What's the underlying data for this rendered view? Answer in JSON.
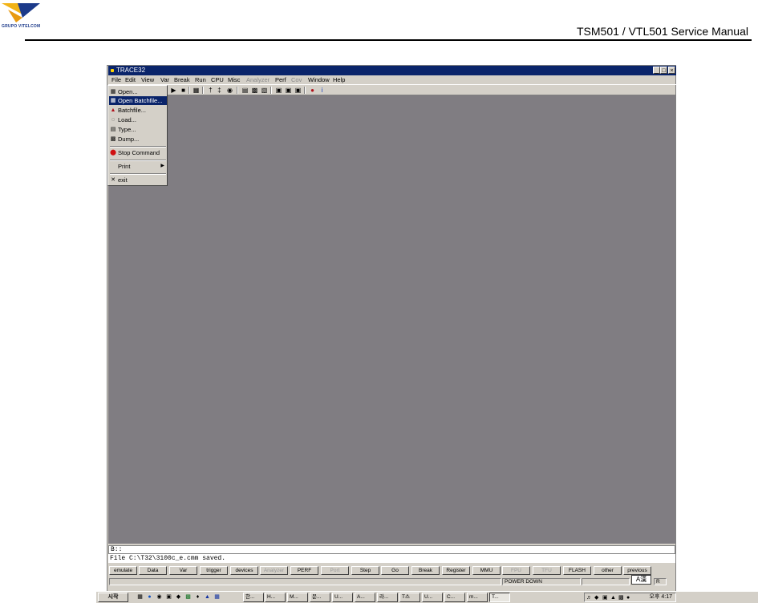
{
  "header": {
    "logo_text": "GRUPO VITELCOM",
    "manual_title": "TSM501 / VTL501 Service Manual"
  },
  "window": {
    "title": "TRACE32",
    "controls": [
      "_",
      "□",
      "×"
    ]
  },
  "menubar": [
    {
      "label": "File",
      "enabled": true
    },
    {
      "label": "Edit",
      "enabled": true
    },
    {
      "label": "View",
      "enabled": true
    },
    {
      "label": "Var",
      "enabled": true
    },
    {
      "label": "Break",
      "enabled": true
    },
    {
      "label": "Run",
      "enabled": true
    },
    {
      "label": "CPU",
      "enabled": true
    },
    {
      "label": "Misc",
      "enabled": true
    },
    {
      "label": "Analyzer",
      "enabled": false
    },
    {
      "label": "Perf",
      "enabled": true
    },
    {
      "label": "Cov",
      "enabled": false
    },
    {
      "label": "Window",
      "enabled": true
    },
    {
      "label": "Help",
      "enabled": true
    }
  ],
  "file_menu": {
    "items": [
      {
        "label": "Open...",
        "icon": "open-file-icon"
      },
      {
        "label": "Open Batchfile...",
        "icon": "open-batchfile-icon",
        "selected": true
      },
      {
        "label": "Batchfile...",
        "icon": "batchfile-icon"
      },
      {
        "label": "Load...",
        "icon": "load-icon"
      },
      {
        "label": "Type...",
        "icon": "type-icon"
      },
      {
        "label": "Dump...",
        "icon": "dump-icon"
      },
      {
        "label": "Stop Command",
        "icon": "stop-icon"
      },
      {
        "label": "Print",
        "icon": "",
        "submenu": true
      },
      {
        "label": "exit",
        "icon": "exit-icon"
      }
    ]
  },
  "command": {
    "prompt": "B::",
    "message": "File C:\\T32\\3100c_e.cmm saved."
  },
  "command_buttons": [
    {
      "label": "emulate",
      "enabled": true
    },
    {
      "label": "Data",
      "enabled": true
    },
    {
      "label": "Var",
      "enabled": true
    },
    {
      "label": "trigger",
      "enabled": true
    },
    {
      "label": "devices",
      "enabled": true
    },
    {
      "label": "Analyzer",
      "enabled": false
    },
    {
      "label": "PERF",
      "enabled": true
    },
    {
      "label": "Port",
      "enabled": false
    },
    {
      "label": "Step",
      "enabled": true
    },
    {
      "label": "Go",
      "enabled": true
    },
    {
      "label": "Break",
      "enabled": true
    },
    {
      "label": "Register",
      "enabled": true
    },
    {
      "label": "MMU",
      "enabled": true
    },
    {
      "label": "FPU",
      "enabled": false
    },
    {
      "label": "TFU",
      "enabled": false
    },
    {
      "label": "FLASH",
      "enabled": true
    },
    {
      "label": "other",
      "enabled": true
    },
    {
      "label": "previous",
      "enabled": true
    }
  ],
  "status": {
    "power": "POWER DOWN",
    "mode": "R",
    "ime": "A漢"
  },
  "taskbar": {
    "start_label": "시작",
    "tasks": [
      "한...",
      "H...",
      "M...",
      "문...",
      "U...",
      "A...",
      "라...",
      "T스",
      "U...",
      "C...",
      "m...",
      "T..."
    ],
    "clock": "오후 4:17"
  }
}
